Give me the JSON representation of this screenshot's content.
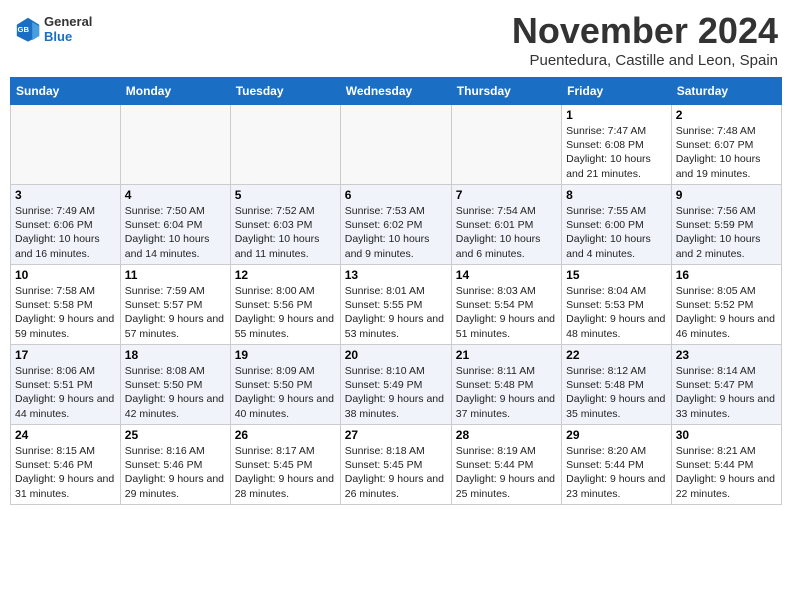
{
  "header": {
    "logo_general": "General",
    "logo_blue": "Blue",
    "month": "November 2024",
    "location": "Puentedura, Castille and Leon, Spain"
  },
  "weekdays": [
    "Sunday",
    "Monday",
    "Tuesday",
    "Wednesday",
    "Thursday",
    "Friday",
    "Saturday"
  ],
  "rows": [
    [
      {
        "day": "",
        "text": "",
        "empty": true
      },
      {
        "day": "",
        "text": "",
        "empty": true
      },
      {
        "day": "",
        "text": "",
        "empty": true
      },
      {
        "day": "",
        "text": "",
        "empty": true
      },
      {
        "day": "",
        "text": "",
        "empty": true
      },
      {
        "day": "1",
        "text": "Sunrise: 7:47 AM\nSunset: 6:08 PM\nDaylight: 10 hours and 21 minutes.",
        "empty": false
      },
      {
        "day": "2",
        "text": "Sunrise: 7:48 AM\nSunset: 6:07 PM\nDaylight: 10 hours and 19 minutes.",
        "empty": false
      }
    ],
    [
      {
        "day": "3",
        "text": "Sunrise: 7:49 AM\nSunset: 6:06 PM\nDaylight: 10 hours and 16 minutes.",
        "empty": false
      },
      {
        "day": "4",
        "text": "Sunrise: 7:50 AM\nSunset: 6:04 PM\nDaylight: 10 hours and 14 minutes.",
        "empty": false
      },
      {
        "day": "5",
        "text": "Sunrise: 7:52 AM\nSunset: 6:03 PM\nDaylight: 10 hours and 11 minutes.",
        "empty": false
      },
      {
        "day": "6",
        "text": "Sunrise: 7:53 AM\nSunset: 6:02 PM\nDaylight: 10 hours and 9 minutes.",
        "empty": false
      },
      {
        "day": "7",
        "text": "Sunrise: 7:54 AM\nSunset: 6:01 PM\nDaylight: 10 hours and 6 minutes.",
        "empty": false
      },
      {
        "day": "8",
        "text": "Sunrise: 7:55 AM\nSunset: 6:00 PM\nDaylight: 10 hours and 4 minutes.",
        "empty": false
      },
      {
        "day": "9",
        "text": "Sunrise: 7:56 AM\nSunset: 5:59 PM\nDaylight: 10 hours and 2 minutes.",
        "empty": false
      }
    ],
    [
      {
        "day": "10",
        "text": "Sunrise: 7:58 AM\nSunset: 5:58 PM\nDaylight: 9 hours and 59 minutes.",
        "empty": false
      },
      {
        "day": "11",
        "text": "Sunrise: 7:59 AM\nSunset: 5:57 PM\nDaylight: 9 hours and 57 minutes.",
        "empty": false
      },
      {
        "day": "12",
        "text": "Sunrise: 8:00 AM\nSunset: 5:56 PM\nDaylight: 9 hours and 55 minutes.",
        "empty": false
      },
      {
        "day": "13",
        "text": "Sunrise: 8:01 AM\nSunset: 5:55 PM\nDaylight: 9 hours and 53 minutes.",
        "empty": false
      },
      {
        "day": "14",
        "text": "Sunrise: 8:03 AM\nSunset: 5:54 PM\nDaylight: 9 hours and 51 minutes.",
        "empty": false
      },
      {
        "day": "15",
        "text": "Sunrise: 8:04 AM\nSunset: 5:53 PM\nDaylight: 9 hours and 48 minutes.",
        "empty": false
      },
      {
        "day": "16",
        "text": "Sunrise: 8:05 AM\nSunset: 5:52 PM\nDaylight: 9 hours and 46 minutes.",
        "empty": false
      }
    ],
    [
      {
        "day": "17",
        "text": "Sunrise: 8:06 AM\nSunset: 5:51 PM\nDaylight: 9 hours and 44 minutes.",
        "empty": false
      },
      {
        "day": "18",
        "text": "Sunrise: 8:08 AM\nSunset: 5:50 PM\nDaylight: 9 hours and 42 minutes.",
        "empty": false
      },
      {
        "day": "19",
        "text": "Sunrise: 8:09 AM\nSunset: 5:50 PM\nDaylight: 9 hours and 40 minutes.",
        "empty": false
      },
      {
        "day": "20",
        "text": "Sunrise: 8:10 AM\nSunset: 5:49 PM\nDaylight: 9 hours and 38 minutes.",
        "empty": false
      },
      {
        "day": "21",
        "text": "Sunrise: 8:11 AM\nSunset: 5:48 PM\nDaylight: 9 hours and 37 minutes.",
        "empty": false
      },
      {
        "day": "22",
        "text": "Sunrise: 8:12 AM\nSunset: 5:48 PM\nDaylight: 9 hours and 35 minutes.",
        "empty": false
      },
      {
        "day": "23",
        "text": "Sunrise: 8:14 AM\nSunset: 5:47 PM\nDaylight: 9 hours and 33 minutes.",
        "empty": false
      }
    ],
    [
      {
        "day": "24",
        "text": "Sunrise: 8:15 AM\nSunset: 5:46 PM\nDaylight: 9 hours and 31 minutes.",
        "empty": false
      },
      {
        "day": "25",
        "text": "Sunrise: 8:16 AM\nSunset: 5:46 PM\nDaylight: 9 hours and 29 minutes.",
        "empty": false
      },
      {
        "day": "26",
        "text": "Sunrise: 8:17 AM\nSunset: 5:45 PM\nDaylight: 9 hours and 28 minutes.",
        "empty": false
      },
      {
        "day": "27",
        "text": "Sunrise: 8:18 AM\nSunset: 5:45 PM\nDaylight: 9 hours and 26 minutes.",
        "empty": false
      },
      {
        "day": "28",
        "text": "Sunrise: 8:19 AM\nSunset: 5:44 PM\nDaylight: 9 hours and 25 minutes.",
        "empty": false
      },
      {
        "day": "29",
        "text": "Sunrise: 8:20 AM\nSunset: 5:44 PM\nDaylight: 9 hours and 23 minutes.",
        "empty": false
      },
      {
        "day": "30",
        "text": "Sunrise: 8:21 AM\nSunset: 5:44 PM\nDaylight: 9 hours and 22 minutes.",
        "empty": false
      }
    ]
  ]
}
